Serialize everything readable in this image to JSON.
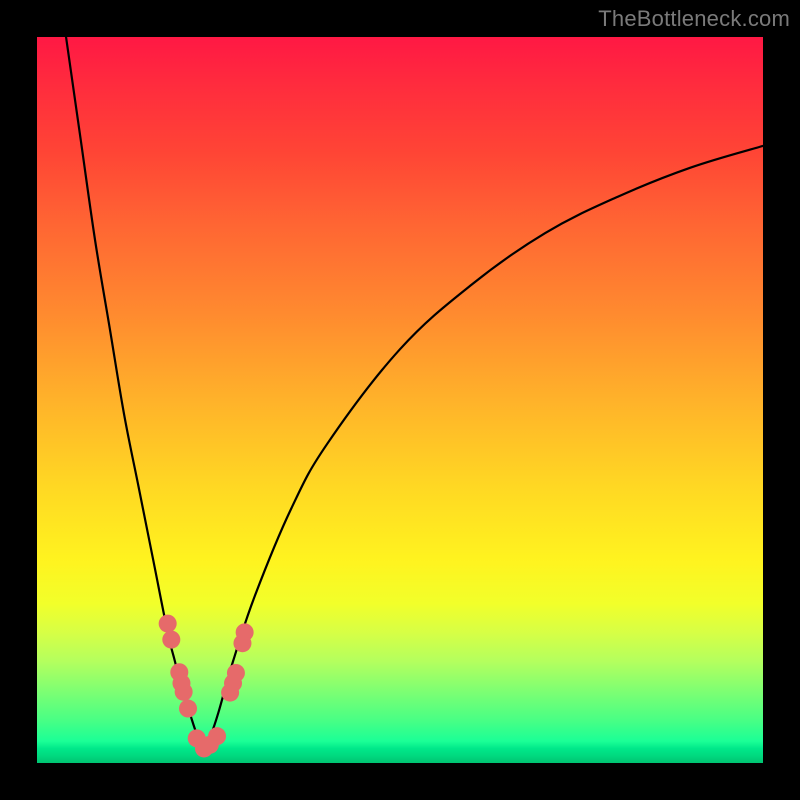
{
  "watermark": "TheBottleneck.com",
  "chart_data": {
    "type": "line",
    "title": "",
    "xlabel": "",
    "ylabel": "",
    "xlim": [
      0,
      100
    ],
    "ylim": [
      0,
      100
    ],
    "background_metric": {
      "comment": "Background color encodes bottleneck severity, top=high (red), bottom=low (green)",
      "stops_pct_from_top": [
        0,
        50,
        75,
        95,
        100
      ],
      "colors": [
        "#ff1844",
        "#ffb22a",
        "#fff31f",
        "#4aff84",
        "#00c472"
      ]
    },
    "series": [
      {
        "name": "bottleneck-curve",
        "comment": "V-shaped bottleneck curve; y is severity (% from top), x is relative component strength. Minimum near x≈23 at y≈98.",
        "x": [
          4,
          6,
          8,
          10,
          12,
          14,
          16,
          18,
          19,
          20,
          21,
          22,
          23,
          24,
          25,
          27,
          30,
          35,
          40,
          50,
          60,
          70,
          80,
          90,
          100
        ],
        "y": [
          0,
          14,
          28,
          40,
          52,
          62,
          72,
          82,
          86,
          90,
          93,
          96,
          98,
          96,
          93,
          86,
          77,
          65,
          56,
          43,
          34,
          27,
          22,
          18,
          15
        ]
      }
    ],
    "markers": {
      "name": "highlighted-points",
      "comment": "Salmon-colored dots near the trough of the curve",
      "x": [
        18.0,
        18.5,
        19.6,
        19.9,
        20.2,
        20.8,
        22.0,
        23.0,
        23.8,
        24.8,
        26.6,
        27.0,
        27.4,
        28.3,
        28.6
      ],
      "y": [
        80.8,
        83.0,
        87.5,
        89.0,
        90.2,
        92.5,
        96.6,
        98.0,
        97.5,
        96.3,
        90.3,
        89.0,
        87.6,
        83.5,
        82.0
      ],
      "color": "#e66a6a",
      "radius_px": 9
    }
  }
}
